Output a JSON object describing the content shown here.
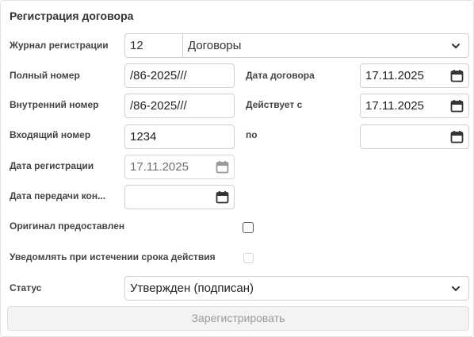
{
  "form": {
    "title": "Регистрация договора",
    "journal": {
      "label": "Журнал регистрации",
      "code": "12",
      "name": "Договоры"
    },
    "full_number": {
      "label": "Полный номер",
      "value": "/86-2025///"
    },
    "internal_number": {
      "label": "Внутренний номер",
      "value": "/86-2025///"
    },
    "incoming_number": {
      "label": "Входящий номер",
      "value": "1234"
    },
    "registration_date": {
      "label": "Дата регистрации",
      "value": "17.11.2025"
    },
    "transfer_date": {
      "label": "Дата передачи кон...",
      "value": ""
    },
    "contract_date": {
      "label": "Дата договора",
      "value": "17.11.2025"
    },
    "valid_from": {
      "label": "Действует с",
      "value": "17.11.2025"
    },
    "valid_to": {
      "label": "по",
      "value": ""
    },
    "original_provided": {
      "label": "Оригинал предоставлен",
      "checked": false
    },
    "notify_expiry": {
      "label": "Уведомлять при истечении срока действия",
      "checked": false,
      "disabled": true
    },
    "status": {
      "label": "Статус",
      "value": "Утвержден (подписан)"
    },
    "register_button": "Зарегистрировать"
  },
  "icons": {
    "calendar": "calendar-icon",
    "chevron": "chevron-down-icon"
  }
}
